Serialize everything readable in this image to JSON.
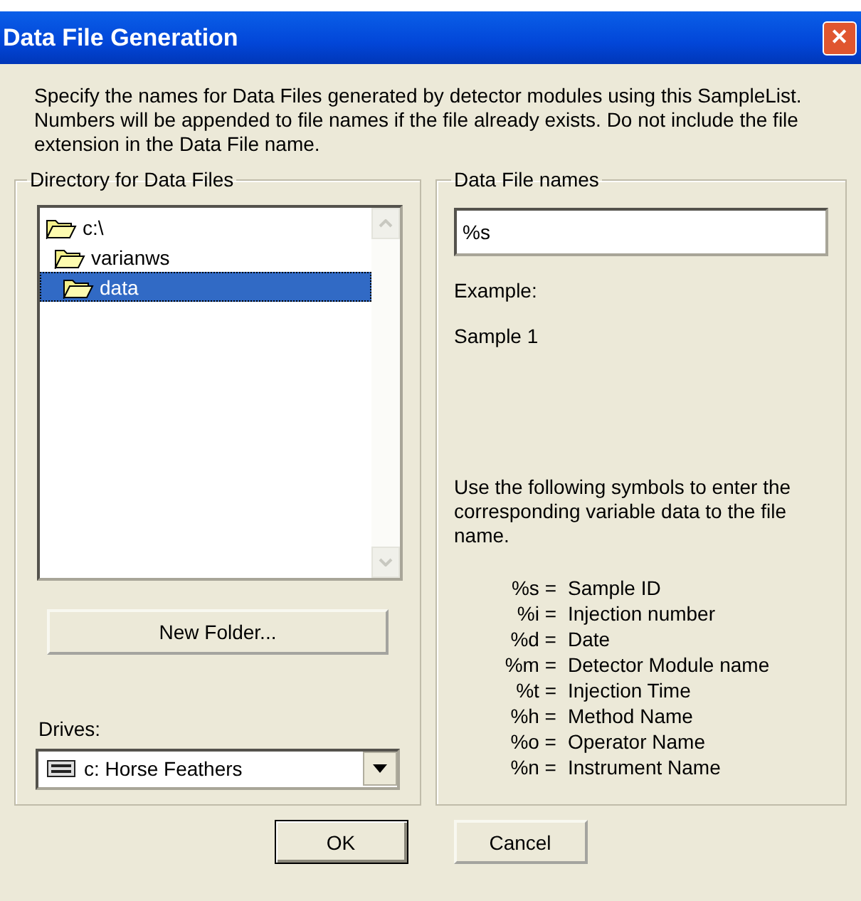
{
  "window": {
    "title": "Data File Generation",
    "close": "✕"
  },
  "description": "Specify the names for Data Files generated by detector modules using this SampleList. Numbers will be appended to file names if the file already exists. Do not include the file extension in the Data File name.",
  "directory": {
    "label": "Directory for Data Files",
    "tree": [
      {
        "name": "c:\\",
        "selected": false,
        "children": [
          {
            "name": "varianws",
            "selected": false,
            "children": [
              {
                "name": "data",
                "selected": true
              }
            ]
          }
        ]
      }
    ],
    "new_folder": "New Folder...",
    "drives_label": "Drives:",
    "drive": "c: Horse Feathers"
  },
  "names": {
    "label": "Data File names",
    "value": "%s",
    "example_label": "Example:",
    "example": "Sample 1",
    "help": "Use the following symbols to enter the corresponding variable data to the file name.",
    "symbols": [
      {
        "code": "%s =",
        "meaning": "Sample ID"
      },
      {
        "code": "%i =",
        "meaning": "Injection number"
      },
      {
        "code": "%d =",
        "meaning": "Date"
      },
      {
        "code": "%m =",
        "meaning": "Detector Module name"
      },
      {
        "code": "%t =",
        "meaning": "Injection Time"
      },
      {
        "code": "%h =",
        "meaning": "Method Name"
      },
      {
        "code": "%o =",
        "meaning": "Operator Name"
      },
      {
        "code": "%n =",
        "meaning": "Instrument Name"
      }
    ]
  },
  "buttons": [
    "OK",
    "Cancel"
  ]
}
